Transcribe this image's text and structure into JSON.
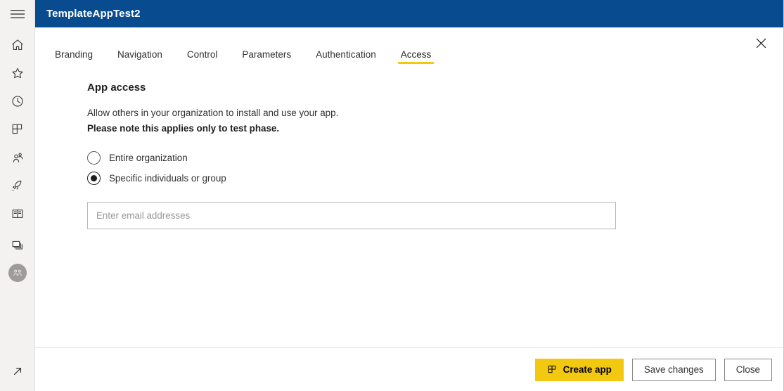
{
  "colors": {
    "header_blue": "#084b8e",
    "accent_yellow": "#f2c811",
    "rail_background": "#f3f2f1",
    "text_primary": "#201f1e",
    "text_secondary": "#323130"
  },
  "rail": {
    "menu": {
      "label": "Menu",
      "icon": "hamburger-icon"
    },
    "items": [
      {
        "name": "home",
        "label": "Home",
        "icon": "home-icon"
      },
      {
        "name": "favorites",
        "label": "Favorites",
        "icon": "star-icon"
      },
      {
        "name": "recent",
        "label": "Recent",
        "icon": "clock-icon"
      },
      {
        "name": "apps",
        "label": "Apps",
        "icon": "apps-grid-icon"
      },
      {
        "name": "shared",
        "label": "Shared with me",
        "icon": "people-icon"
      },
      {
        "name": "deployment",
        "label": "Deployment pipelines",
        "icon": "rocket-icon"
      },
      {
        "name": "learn",
        "label": "Learn",
        "icon": "book-icon"
      }
    ],
    "bottom_items": [
      {
        "name": "workspaces",
        "label": "Workspaces",
        "icon": "workspaces-icon"
      },
      {
        "name": "workspace-avatar",
        "label": "Workspace",
        "icon": "group-avatar-icon"
      }
    ],
    "expand": {
      "label": "Expand",
      "icon": "expand-arrow-icon"
    }
  },
  "header": {
    "title": "TemplateAppTest2",
    "close_label": "Close",
    "close_icon": "close-icon"
  },
  "tabs": [
    {
      "label": "Branding",
      "active": false
    },
    {
      "label": "Navigation",
      "active": false
    },
    {
      "label": "Control",
      "active": false
    },
    {
      "label": "Parameters",
      "active": false
    },
    {
      "label": "Authentication",
      "active": false
    },
    {
      "label": "Access",
      "active": true
    }
  ],
  "main": {
    "section_title": "App access",
    "description_line1": "Allow others in your organization to install and use your app.",
    "description_line2": "Please note this applies only to test phase.",
    "radio_options": [
      {
        "label": "Entire organization",
        "selected": false
      },
      {
        "label": "Specific individuals or group",
        "selected": true
      }
    ],
    "email_input": {
      "value": "",
      "placeholder": "Enter email addresses"
    }
  },
  "footer": {
    "create_app": {
      "label": "Create app",
      "icon": "apps-grid-icon"
    },
    "save_changes": {
      "label": "Save changes"
    },
    "close": {
      "label": "Close"
    }
  }
}
